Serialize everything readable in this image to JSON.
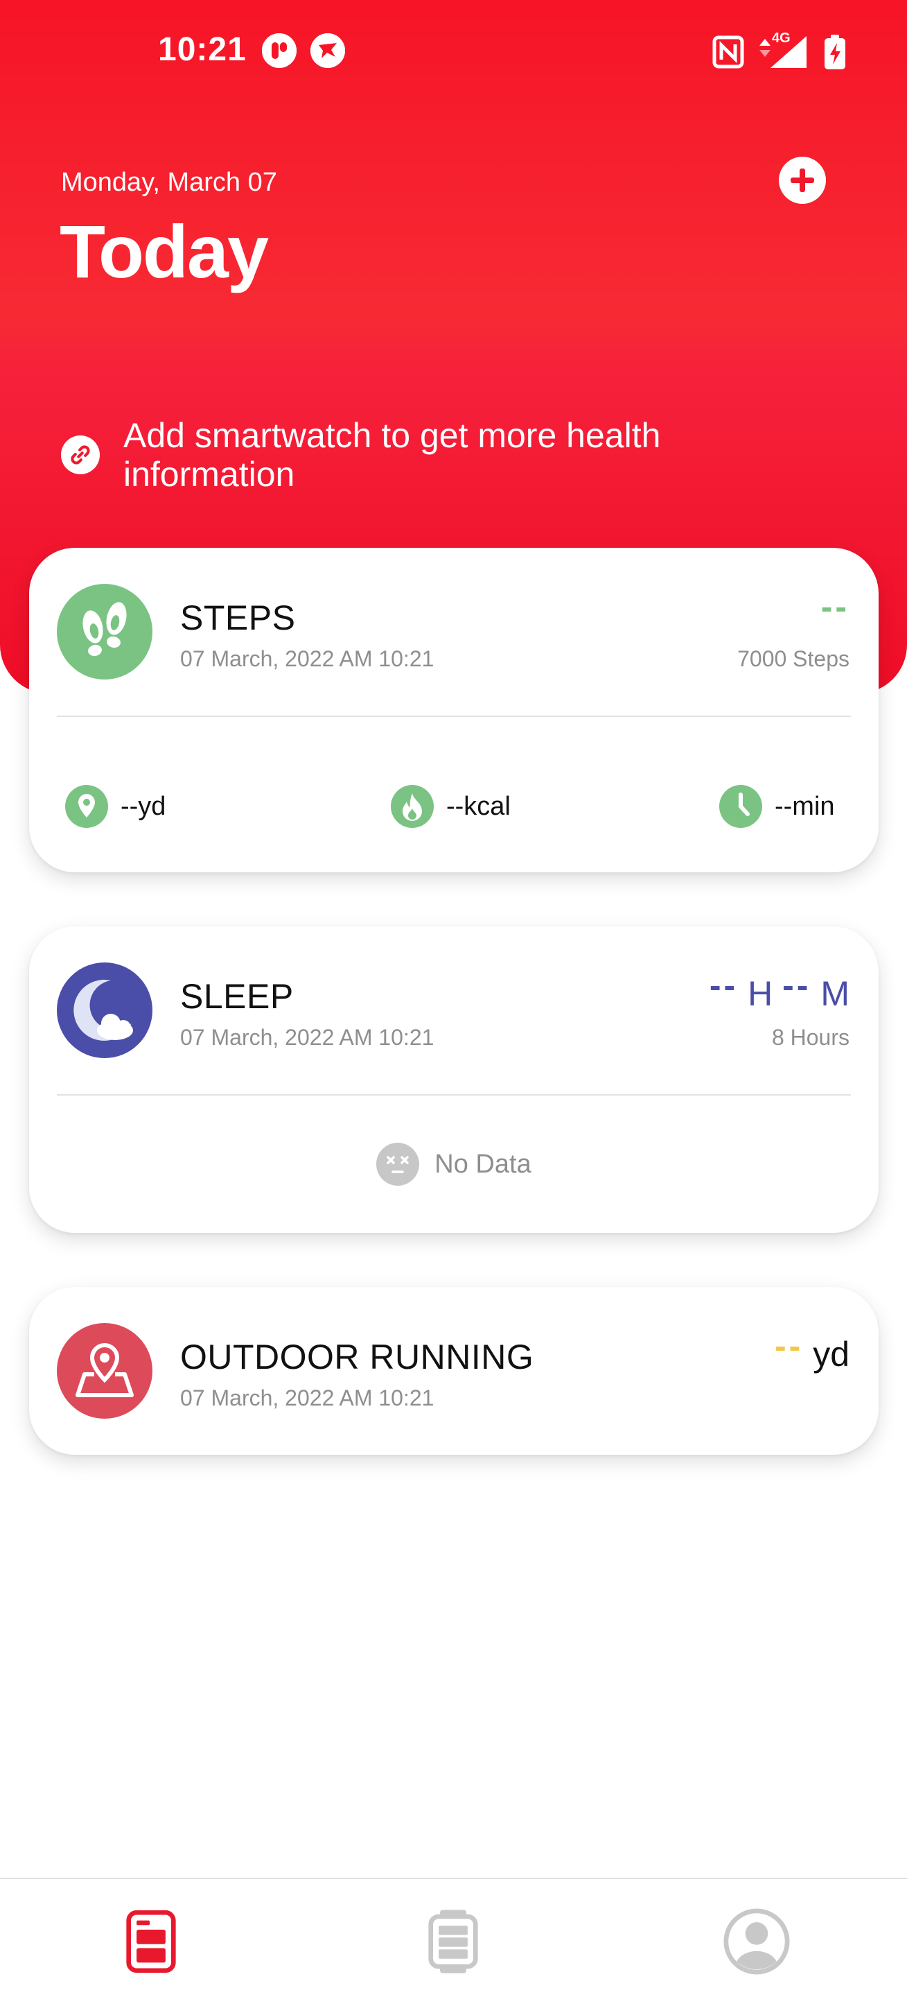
{
  "status_bar": {
    "time": "10:21",
    "network": "4G",
    "icons": [
      "app-notification-icon",
      "app-notification-icon-2",
      "nfc-icon",
      "data-arrows-icon",
      "signal-icon",
      "battery-charging-icon"
    ]
  },
  "header": {
    "date": "Monday, March 07",
    "title": "Today",
    "add_icon": "plus-icon"
  },
  "promo": {
    "text": "Add smartwatch to get more health information",
    "icon": "link-icon"
  },
  "cards": {
    "steps": {
      "title": "STEPS",
      "timestamp": "07 March, 2022 AM 10:21",
      "value": "--",
      "goal": "7000 Steps",
      "metrics": [
        {
          "icon": "location-pin-icon",
          "text": "--yd"
        },
        {
          "icon": "flame-icon",
          "text": "--kcal"
        },
        {
          "icon": "clock-icon",
          "text": "--min"
        }
      ]
    },
    "sleep": {
      "title": "SLEEP",
      "timestamp": "07 March, 2022 AM 10:21",
      "value_hours": "--",
      "unit_hours": "H",
      "value_minutes": "--",
      "unit_minutes": "M",
      "goal": "8 Hours",
      "no_data": "No Data"
    },
    "running": {
      "title": "OUTDOOR RUNNING",
      "timestamp": "07 March, 2022 AM 10:21",
      "value": "--",
      "unit": "yd"
    }
  },
  "colors": {
    "header_red": "#f61426",
    "steps_green": "#7ac383",
    "sleep_blue": "#4a4ea8",
    "running_red": "#dd4a5a",
    "running_value_yellow": "#f4c54a",
    "nav_active": "#e8192c",
    "nav_inactive": "#c8c8c8"
  },
  "bottom_nav": {
    "items": [
      {
        "icon": "dashboard-icon",
        "active": true
      },
      {
        "icon": "watch-icon",
        "active": false
      },
      {
        "icon": "profile-icon",
        "active": false
      }
    ]
  }
}
